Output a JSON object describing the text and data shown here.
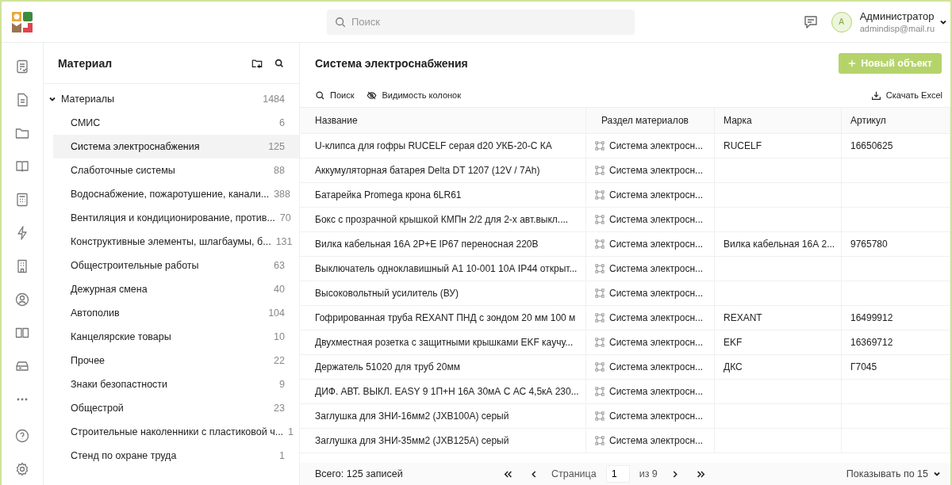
{
  "header": {
    "search": {
      "placeholder": "Поиск"
    },
    "user": {
      "initial": "А",
      "name": "Администратор",
      "email": "admindisp@mail.ru"
    }
  },
  "rail": {
    "items": [
      {
        "kind": "checklist"
      },
      {
        "kind": "document"
      },
      {
        "kind": "folder"
      },
      {
        "kind": "book"
      },
      {
        "kind": "calculator"
      },
      {
        "kind": "bolt"
      },
      {
        "kind": "building"
      },
      {
        "kind": "user"
      },
      {
        "kind": "book-open"
      },
      {
        "kind": "drive"
      },
      {
        "kind": "more"
      }
    ],
    "bottom": [
      {
        "kind": "help"
      },
      {
        "kind": "settings"
      }
    ]
  },
  "tree_panel": {
    "title": "Материал",
    "root": {
      "label": "Материалы",
      "count": "1484",
      "expanded": true,
      "children": [
        {
          "label": "СМИС",
          "count": "6",
          "selected": false
        },
        {
          "label": "Система электроснабжения",
          "count": "125",
          "selected": true
        },
        {
          "label": "Слаботочные системы",
          "count": "88",
          "selected": false
        },
        {
          "label": "Водоснабжение, пожаротушение, канали...",
          "count": "388",
          "selected": false
        },
        {
          "label": "Вентиляция и кондиционирование, против...",
          "count": "70",
          "selected": false
        },
        {
          "label": "Конструктивные элементы, шлагбаумы, б...",
          "count": "131",
          "selected": false
        },
        {
          "label": "Общестроительные работы",
          "count": "63",
          "selected": false
        },
        {
          "label": "Дежурная смена",
          "count": "40",
          "selected": false
        },
        {
          "label": "Автополив",
          "count": "104",
          "selected": false
        },
        {
          "label": "Канцелярские товары",
          "count": "10",
          "selected": false
        },
        {
          "label": "Прочее",
          "count": "22",
          "selected": false
        },
        {
          "label": "Знаки безопастности",
          "count": "9",
          "selected": false
        },
        {
          "label": "Общестрой",
          "count": "23",
          "selected": false
        },
        {
          "label": "Строительные наколенники с пластиковой ч...",
          "count": "1",
          "selected": false
        },
        {
          "label": "Стенд по охране труда",
          "count": "1",
          "selected": false
        }
      ]
    }
  },
  "main": {
    "title": "Система электроснабжения",
    "new_button": "Новый объект",
    "toolbar": {
      "search": "Поиск",
      "columns": "Видимость колонок",
      "download": "Скачать Excel"
    },
    "table": {
      "columns": [
        "Название",
        "Раздел материалов",
        "Марка",
        "Артикул"
      ],
      "rows": [
        {
          "name": "U-клипса для гофры RUCELF серая d20 УКБ-20-С КА",
          "section": "Система электросн...",
          "brand": "RUCELF",
          "article": "16650625"
        },
        {
          "name": "Аккумуляторная батарея Delta DT 1207 (12V / 7Ah)",
          "section": "Система электросн..."
        },
        {
          "name": "Батарейка Promega крона 6LR61",
          "section": "Система электросн..."
        },
        {
          "name": "Бокс с прозрачной крышкой  КМПн 2/2 для 2-х авт.выкл....",
          "section": "Система электросн..."
        },
        {
          "name": "Вилка кабельная 16А 2Р+Е IP67 переносная 220В",
          "section": "Система электросн...",
          "brand": "Вилка кабельная 16А 2...",
          "article": "9765780"
        },
        {
          "name": "Выключатель одноклавишный А1 10-001 10А IP44 открыт...",
          "section": "Система электросн..."
        },
        {
          "name": "Высоковольтный усилитель (ВУ)",
          "section": "Система электросн..."
        },
        {
          "name": "Гофрированная труба REXANT ПНД с зондом 20 мм 100 м",
          "section": "Система электросн...",
          "brand": "REXANT",
          "article": "16499912"
        },
        {
          "name": "Двухместная розетка с защитными крышками EKF каучу...",
          "section": "Система электросн...",
          "brand": "EKF",
          "article": "16369712"
        },
        {
          "name": "Держатель 51020 для труб 20мм",
          "section": "Система электросн...",
          "brand": "ДКС",
          "article": "Г7045"
        },
        {
          "name": "ДИФ. АВТ. ВЫКЛ. EASY 9 1П+Н 16А 30мА С АС 4,5кА 230...",
          "section": "Система электросн..."
        },
        {
          "name": "Заглушка для ЗНИ-16мм2 (JXB100A) серый",
          "section": "Система электросн..."
        },
        {
          "name": "Заглушка для ЗНИ-35мм2 (JXB125A) серый",
          "section": "Система электросн..."
        }
      ]
    },
    "footer": {
      "total": "Всего: 125 записей",
      "page_label": "Страница",
      "page": "1",
      "of": "из 9",
      "page_size": "Показывать по 15"
    }
  }
}
